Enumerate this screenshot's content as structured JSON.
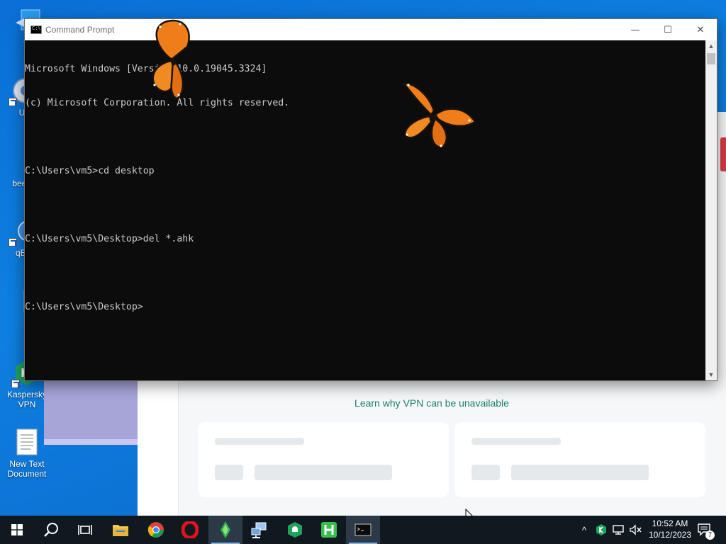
{
  "desktop": {
    "icons": [
      {
        "label": "Th",
        "icon": "this-pc-icon"
      },
      {
        "label": "Ult",
        "icon": "ultraviewer-icon"
      },
      {
        "label": "beebe",
        "icon": "folder-icon"
      },
      {
        "label": "qBitt",
        "icon": "qbittorrent-icon"
      },
      {
        "label": "",
        "icon": "document-icon"
      },
      {
        "label": "Kaspersky VPN",
        "icon": "kaspersky-vpn-icon"
      },
      {
        "label": "New Text Document",
        "icon": "text-document-icon"
      }
    ]
  },
  "vpn_app": {
    "learn_link": "Learn why VPN can be unavailable",
    "accent_color": "#1a7f6e"
  },
  "cmd": {
    "title": "Command Prompt",
    "lines": [
      "Microsoft Windows [Version 10.0.19045.3324]",
      "(c) Microsoft Corporation. All rights reserved.",
      "",
      "C:\\Users\\vm5>cd desktop",
      "",
      "C:\\Users\\vm5\\Desktop>del *.ahk",
      "",
      "C:\\Users\\vm5\\Desktop>"
    ],
    "minimize_glyph": "—",
    "maximize_glyph": "☐",
    "close_glyph": "✕"
  },
  "taskbar": {
    "apps": [
      {
        "name": "start-button",
        "icon": "windows-logo-icon"
      },
      {
        "name": "search-button",
        "icon": "search-icon"
      },
      {
        "name": "task-view-button",
        "icon": "task-view-icon"
      },
      {
        "name": "file-explorer-button",
        "icon": "folder-icon"
      },
      {
        "name": "chrome-button",
        "icon": "chrome-icon"
      },
      {
        "name": "opera-button",
        "icon": "opera-icon"
      },
      {
        "name": "kaspersky-vpn-button",
        "icon": "kaspersky-icon"
      },
      {
        "name": "network-app-button",
        "icon": "network-computer-icon"
      },
      {
        "name": "kaspersky-secure-button",
        "icon": "kaspersky-shield-icon"
      },
      {
        "name": "h-app-button",
        "icon": "h-app-icon"
      },
      {
        "name": "cmd-taskbar-button",
        "icon": "cmd-icon"
      }
    ],
    "time": "10:52 AM",
    "date": "10/12/2023",
    "notification_count": "7"
  }
}
